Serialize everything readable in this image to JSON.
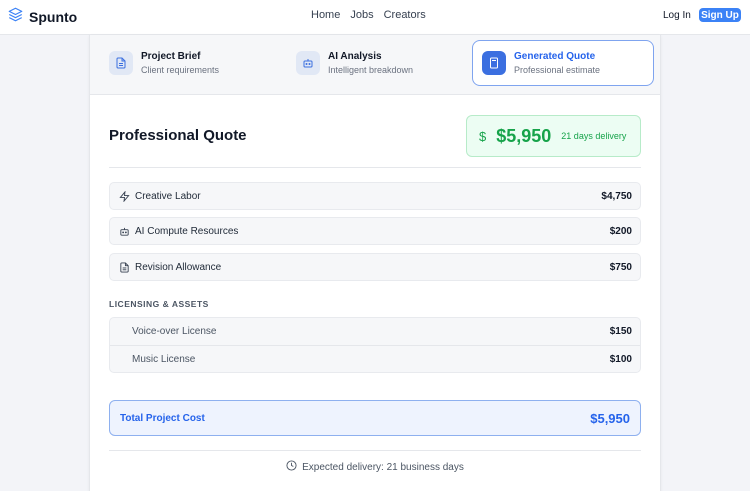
{
  "brand": {
    "name": "Spunto"
  },
  "nav": {
    "items": [
      "Home",
      "Jobs",
      "Creators"
    ],
    "login": "Log In",
    "signup": "Sign Up"
  },
  "steps": [
    {
      "title": "Project Brief",
      "subtitle": "Client requirements",
      "icon": "document-icon"
    },
    {
      "title": "AI Analysis",
      "subtitle": "Intelligent breakdown",
      "icon": "robot-icon"
    },
    {
      "title": "Generated Quote",
      "subtitle": "Professional estimate",
      "icon": "calculator-icon",
      "active": true
    }
  ],
  "quote": {
    "title": "Professional Quote",
    "price": "$5,950",
    "delivery_badge": "21 days delivery",
    "line_items": [
      {
        "label": "Creative Labor",
        "value": "$4,750",
        "icon": "sparkle-icon"
      },
      {
        "label": "AI Compute Resources",
        "value": "$200",
        "icon": "robot-icon"
      },
      {
        "label": "Revision Allowance",
        "value": "$750",
        "icon": "document-icon"
      }
    ],
    "licensing_heading": "LICENSING & ASSETS",
    "licensing": [
      {
        "label": "Voice-over License",
        "value": "$150"
      },
      {
        "label": "Music License",
        "value": "$100"
      }
    ],
    "total_label": "Total Project Cost",
    "total_value": "$5,950",
    "expected_delivery": "Expected delivery: 21 business days"
  },
  "colors": {
    "accent": "#3b82f6",
    "success": "#16a34a"
  }
}
